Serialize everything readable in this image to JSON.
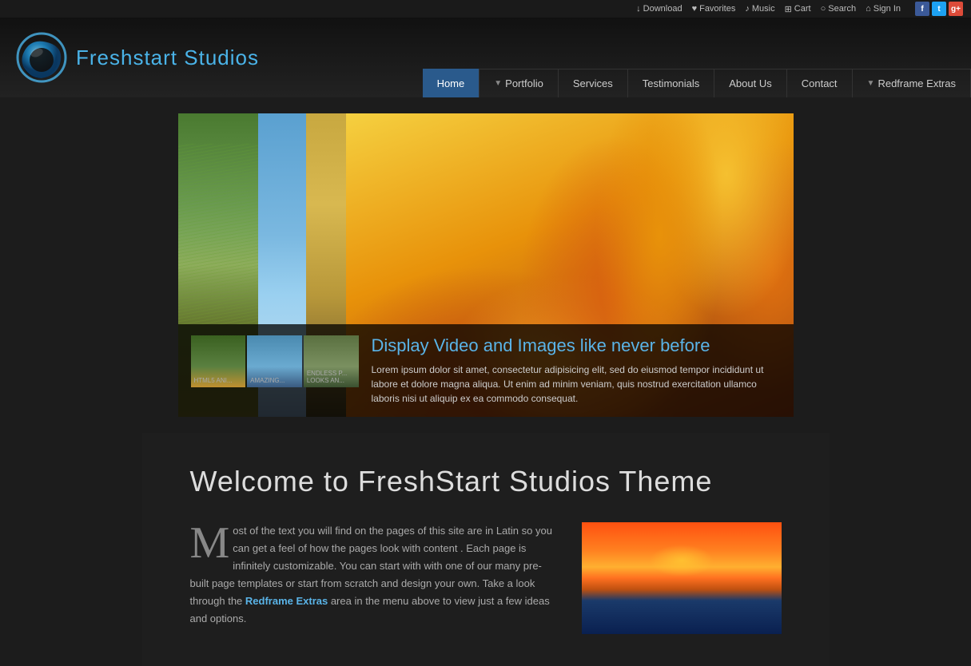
{
  "topbar": {
    "download": "Download",
    "favorites": "Favorites",
    "music": "Music",
    "cart": "Cart",
    "search": "Search",
    "signin": "Sign In",
    "download_icon": "↓",
    "favorites_icon": "♥",
    "music_icon": "♪",
    "cart_icon": "🛒",
    "search_icon": "🔍",
    "signin_icon": "👤"
  },
  "header": {
    "logo_text_main": "Freshstart ",
    "logo_text_accent": "Studios",
    "nav": {
      "home": "Home",
      "portfolio": "Portfolio",
      "services": "Services",
      "testimonials": "Testimonials",
      "about": "About Us",
      "contact": "Contact",
      "redframe": "Redframe Extras"
    }
  },
  "slider": {
    "title": "Display Video and Images like never before",
    "description": "Lorem ipsum dolor sit amet, consectetur adipisicing elit, sed do eiusmod tempor incididunt ut labore et dolore magna aliqua. Ut enim ad minim veniam, quis nostrud exercitation ullamco laboris nisi ut aliquip ex ea commodo consequat.",
    "thumb1_label": "HTML5 ANI...",
    "thumb2_label": "AMAZING...",
    "thumb3_label": "ENDLESS P... LOOKS AN..."
  },
  "content": {
    "welcome_title": "Welcome to FreshStart Studios Theme",
    "body_text": "ost of the text you will find on the pages of this site are in Latin so you can get a feel of how the pages look with content . Each page is infinitely customizable. You can start with with one of our many pre-built page templates or start from scratch and design your own. Take a look through the ",
    "redframe_link": "Redframe Extras",
    "body_text_end": " area in the menu above to view just a few ideas and options.",
    "drop_cap": "M"
  }
}
